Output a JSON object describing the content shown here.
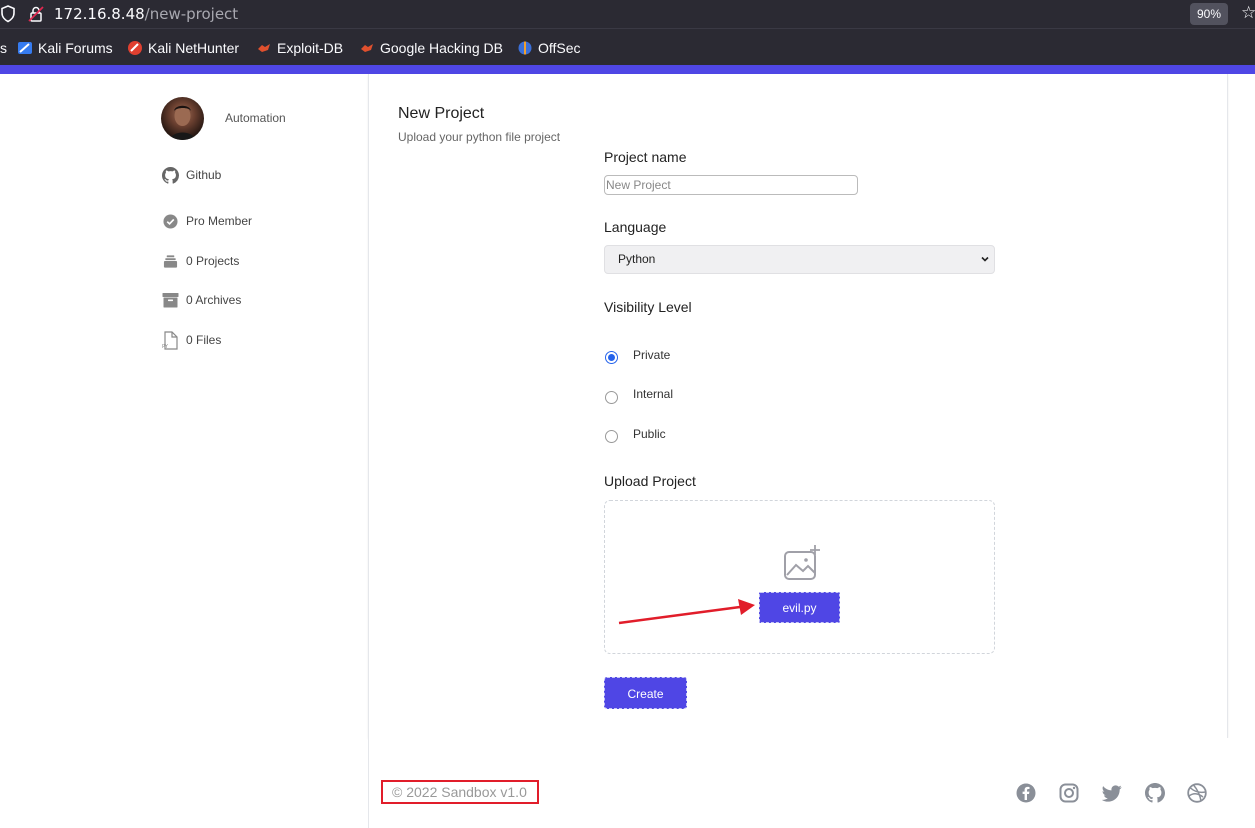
{
  "browser": {
    "url_host": "172.16.8.48",
    "url_path": "/new-project",
    "zoom": "90%",
    "bookmarks": [
      {
        "label": "s",
        "icon": "none"
      },
      {
        "label": "Kali Forums",
        "icon": "kali-forums-icon"
      },
      {
        "label": "Kali NetHunter",
        "icon": "kali-nethunter-icon"
      },
      {
        "label": "Exploit-DB",
        "icon": "exploit-db-icon"
      },
      {
        "label": "Google Hacking DB",
        "icon": "ghdb-icon"
      },
      {
        "label": "OffSec",
        "icon": "offsec-icon"
      }
    ]
  },
  "sidebar": {
    "profile_name": "Automation",
    "items": [
      {
        "label": "Github",
        "icon": "github-icon"
      },
      {
        "label": "Pro Member",
        "icon": "check-badge-icon"
      },
      {
        "label": "0 Projects",
        "icon": "stack-icon"
      },
      {
        "label": "0 Archives",
        "icon": "archive-icon"
      },
      {
        "label": "0 Files",
        "icon": "python-file-icon"
      }
    ]
  },
  "form": {
    "title": "New Project",
    "subtitle": "Upload your python file project",
    "project_name_label": "Project name",
    "project_name_placeholder": "New Project",
    "project_name_value": "",
    "language_label": "Language",
    "language_selected": "Python",
    "visibility_label": "Visibility Level",
    "visibility_options": [
      {
        "label": "Private",
        "checked": true
      },
      {
        "label": "Internal",
        "checked": false
      },
      {
        "label": "Public",
        "checked": false
      }
    ],
    "upload_label": "Upload Project",
    "uploaded_file": "evil.py",
    "create_label": "Create"
  },
  "footer": {
    "copyright": "© 2022 Sandbox v1.0",
    "social": [
      "facebook-icon",
      "instagram-icon",
      "twitter-icon",
      "github-icon",
      "dribbble-icon"
    ]
  },
  "colors": {
    "accent": "#4f46e5",
    "annotation_red": "#e11d2a",
    "browser_chrome": "#2b2a33"
  }
}
